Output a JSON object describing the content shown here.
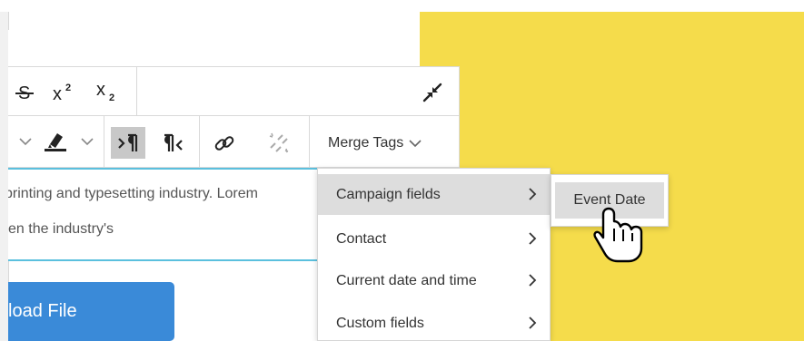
{
  "toolbar": {
    "row1": [
      "strikethrough-icon",
      "superscript-icon",
      "subscript-icon",
      "collapse-icon"
    ],
    "row2": [
      "chevron-down-icon",
      "highlight-color-icon",
      "chevron-down-icon",
      "ltr-paragraph-icon",
      "rtl-paragraph-icon",
      "link-icon",
      "unlink-icon"
    ],
    "merge_tags_label": "Merge Tags"
  },
  "editor": {
    "line1": "printing and typesetting industry. Lorem",
    "line2": "en the industry's"
  },
  "upload_button_label": "load File",
  "merge_menu": {
    "items": [
      {
        "label": "Campaign fields",
        "highlighted": true
      },
      {
        "label": "Contact",
        "highlighted": false
      },
      {
        "label": "Current date and time",
        "highlighted": false
      },
      {
        "label": "Custom fields",
        "highlighted": false
      }
    ]
  },
  "submenu": {
    "items": [
      {
        "label": "Event Date"
      }
    ]
  },
  "colors": {
    "background_yellow": "#f5dc4b",
    "button_blue": "#3a8ad8",
    "editor_border_accent": "#5bc0de",
    "menu_highlight": "#dddddd"
  },
  "cursor": "hand-pointer-icon"
}
